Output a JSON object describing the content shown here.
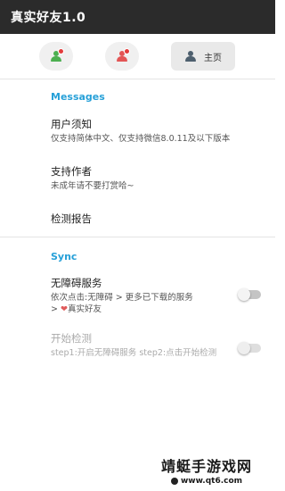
{
  "app": {
    "title": "真实好友1.0"
  },
  "tabs": [
    {
      "icon": "person-icon",
      "color": "#4caf50",
      "badge": true
    },
    {
      "icon": "person-icon",
      "color": "#e35555",
      "badge": true
    },
    {
      "icon": "person-icon",
      "color": "#4d5f6e",
      "label": "主页",
      "active": true
    }
  ],
  "sections": {
    "messages": {
      "title": "Messages",
      "items": [
        {
          "title": "用户须知",
          "subtitle": "仅支持简体中文、仅支持微信8.0.11及以下版本"
        },
        {
          "title": "支持作者",
          "subtitle": "未成年请不要打赏哈~"
        },
        {
          "title": "检测报告"
        }
      ]
    },
    "sync": {
      "title": "Sync",
      "accessibility": {
        "title": "无障碍服务",
        "subtitle_line1": "依次点击:无障碍 > 更多已下载的服务",
        "subtitle_line2_prefix": "> ",
        "heart": "❤",
        "subtitle_line2_suffix": "真实好友",
        "switch_on": false
      },
      "start_check": {
        "title": "开始检测",
        "subtitle": "step1:开启无障碍服务 step2:点击开始检测",
        "switch_on": false,
        "enabled": false
      }
    }
  },
  "watermark": {
    "main": "靖蜓手游戏网",
    "url": "www.qt6.com"
  },
  "colors": {
    "appbar": "#2b2b2b",
    "accent": "#26a0d8",
    "badge": "#e23c3c"
  }
}
